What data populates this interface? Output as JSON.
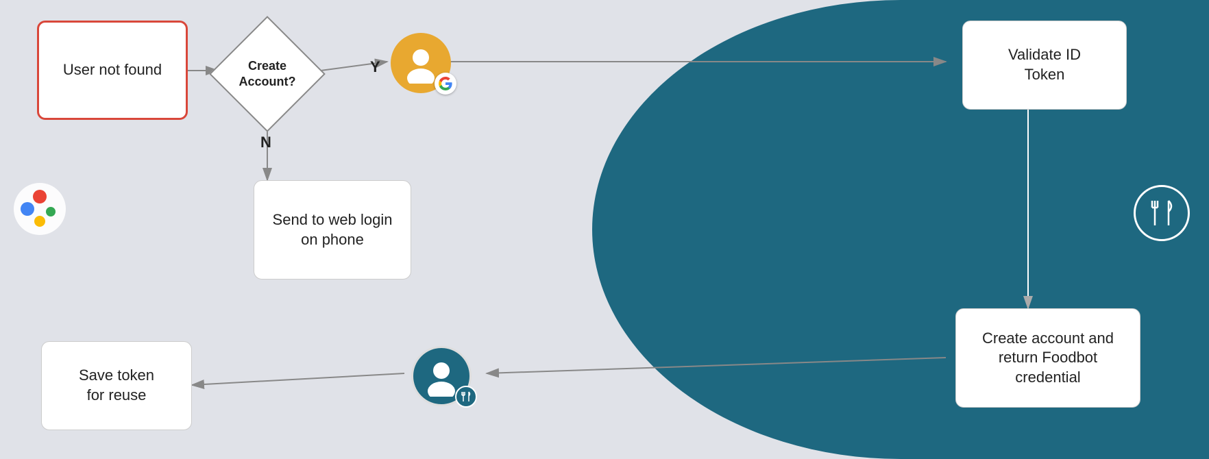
{
  "background": {
    "left_color": "#e0e2e8",
    "right_color": "#1e6880"
  },
  "boxes": {
    "user_not_found": "User not found",
    "create_account_diamond": "Create\nAccount?",
    "web_login": "Send to web login\non phone",
    "save_token": "Save token\nfor reuse",
    "validate_id": "Validate ID\nToken",
    "create_account_box": "Create account and\nreturn Foodbot\ncredential"
  },
  "labels": {
    "yes": "Y",
    "no": "N"
  },
  "icons": {
    "google_assistant": "Google Assistant",
    "google_account": "Google Account",
    "foodbot_account": "Foodbot Account",
    "foodbot_right": "Foodbot"
  }
}
